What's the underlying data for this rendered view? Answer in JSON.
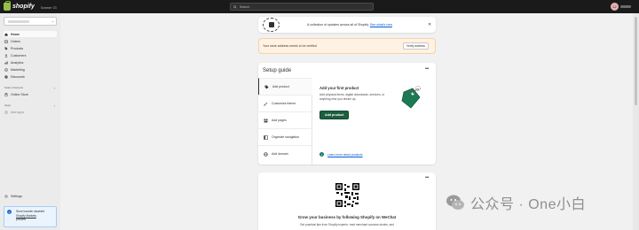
{
  "topbar": {
    "brand": "shopify",
    "edition": "Summer '23",
    "search_placeholder": "Search",
    "user_initials": "LJ"
  },
  "sidebar": {
    "items": [
      {
        "label": "Home",
        "icon": "home-icon",
        "active": true
      },
      {
        "label": "Orders",
        "icon": "orders-icon"
      },
      {
        "label": "Products",
        "icon": "tag-icon"
      },
      {
        "label": "Customers",
        "icon": "person-icon"
      },
      {
        "label": "Analytics",
        "icon": "chart-icon"
      },
      {
        "label": "Marketing",
        "icon": "target-icon"
      },
      {
        "label": "Discounts",
        "icon": "discount-icon"
      }
    ],
    "sales_channels_header": "Sales channels",
    "sales_channels": [
      {
        "label": "Online Store",
        "icon": "store-icon"
      }
    ],
    "apps_header": "Apps",
    "apps": [
      {
        "label": "Add apps",
        "icon": "plus-icon"
      }
    ],
    "settings_label": "Settings",
    "notice": {
      "text": "Store transfer disabled",
      "link1": "Shopify Markets",
      "link2": "preview"
    }
  },
  "banner": {
    "text": "A collection of updates across all of Shopify.",
    "link": "See what's new"
  },
  "verify_banner": {
    "text": "Your store address needs to be verified",
    "button": "Verify address"
  },
  "setup_guide": {
    "title": "Setup guide",
    "steps": [
      {
        "label": "Add product",
        "icon": "tag-icon",
        "active": true
      },
      {
        "label": "Customize theme",
        "icon": "brush-icon"
      },
      {
        "label": "Add pages",
        "icon": "pages-icon"
      },
      {
        "label": "Organize navigation",
        "icon": "navigation-icon"
      },
      {
        "label": "Add domain",
        "icon": "globe-icon"
      }
    ],
    "detail": {
      "title": "Add your first product",
      "description": "Add physical items, digital downloads, services, or anything else you dream up.",
      "button": "Add product",
      "learn_more": "Learn more about products"
    }
  },
  "wechat_card": {
    "title": "Grow your business by following Shopify on WeChat",
    "description": "Get practical tips from Shopify experts, read merchant success stories, and"
  },
  "watermark": {
    "text": "公众号 · One小白"
  },
  "colors": {
    "topbar": "#1a1a1a",
    "primary_button": "#1c5e3d",
    "link": "#005bd3",
    "warning_bg": "#fff1e3",
    "notice_bg": "#eaf4ff"
  }
}
